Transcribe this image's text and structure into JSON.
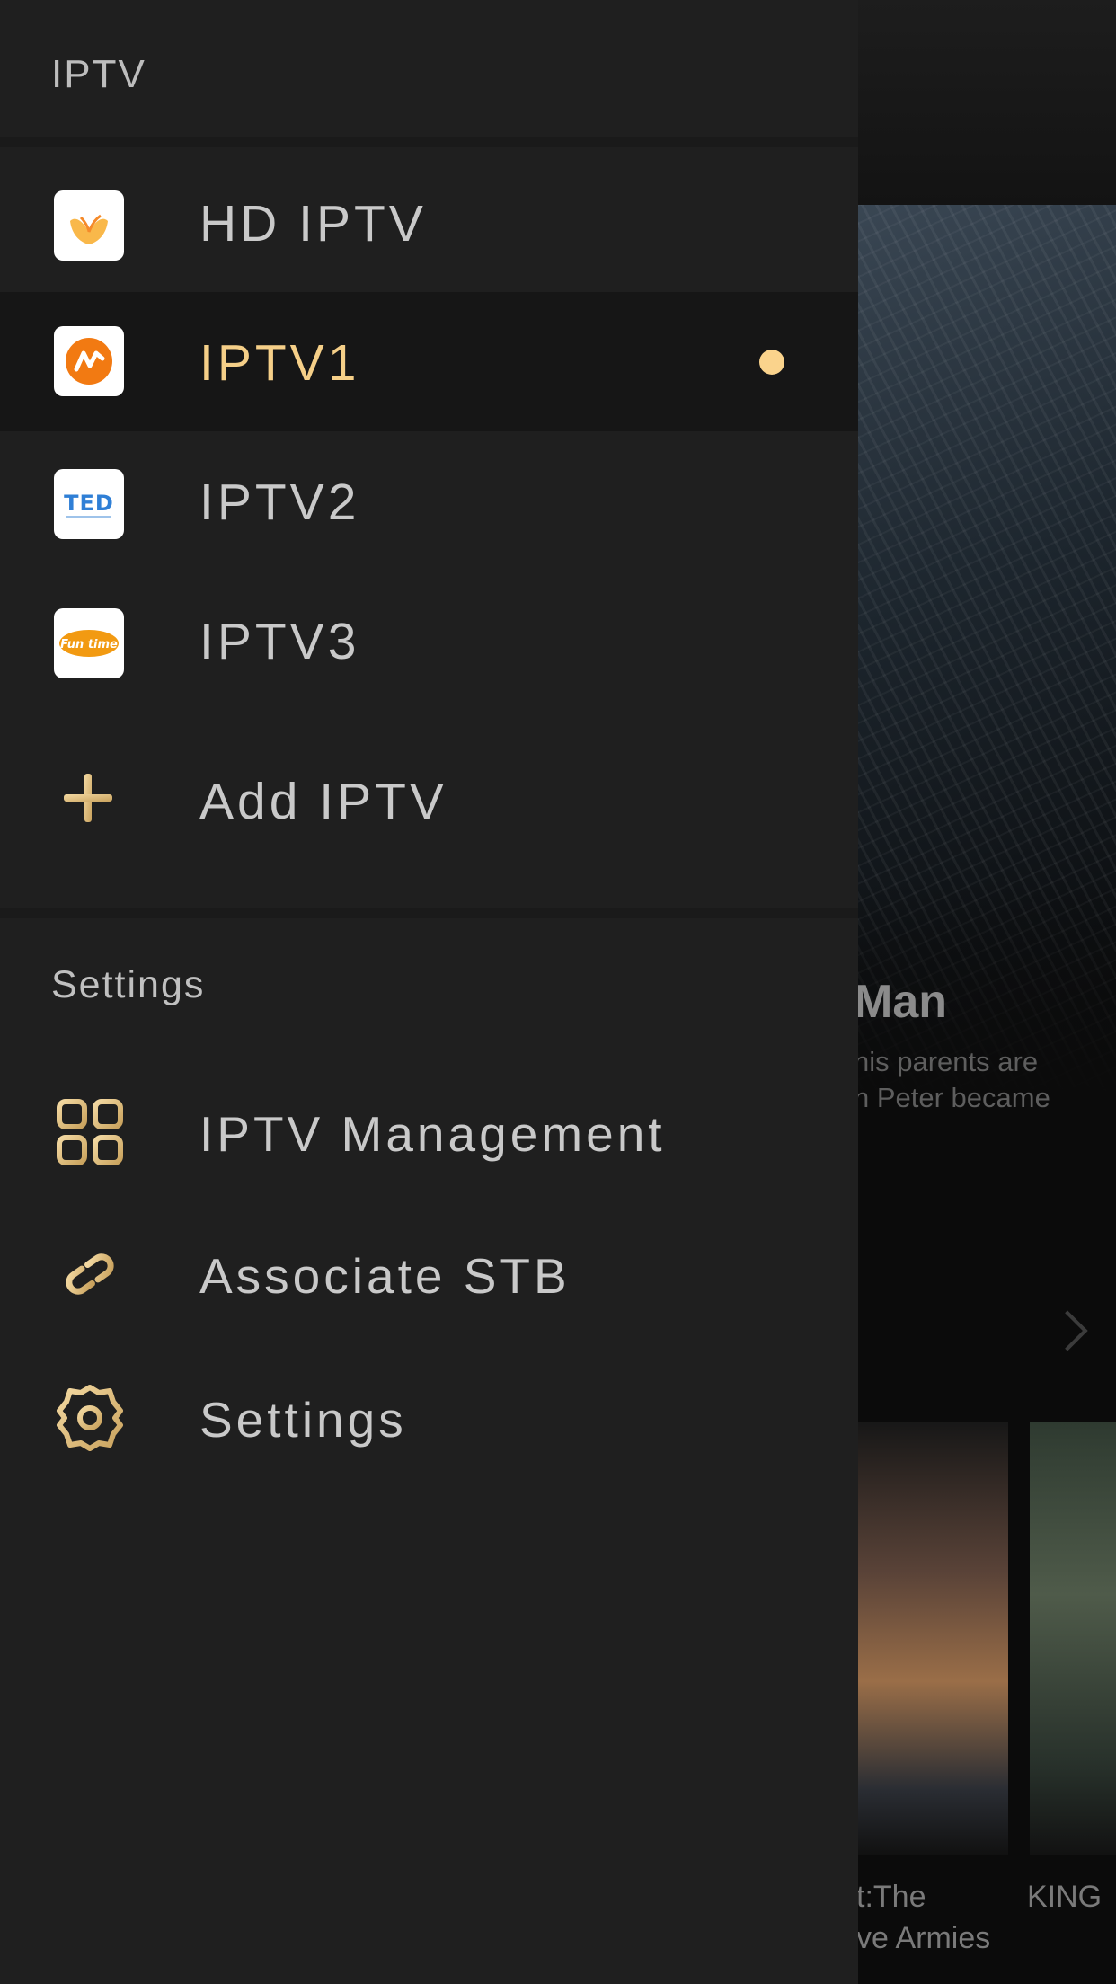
{
  "background": {
    "hero_title": "Man",
    "hero_description": "his parents are\nn Peter became",
    "posters": [
      {
        "title": "t:The\nve Armies"
      },
      {
        "title": "KING"
      }
    ]
  },
  "drawer": {
    "title": "IPTV",
    "items": [
      {
        "label": "HD IPTV",
        "icon": "hd-iptv-logo",
        "selected": false
      },
      {
        "label": "IPTV1",
        "icon": "iptv1-logo",
        "selected": true
      },
      {
        "label": "IPTV2",
        "icon": "ted-logo",
        "selected": false
      },
      {
        "label": "IPTV3",
        "icon": "fun-time-logo",
        "selected": false
      }
    ],
    "add_label": "Add IPTV",
    "settings_section_title": "Settings",
    "settings_items": [
      {
        "label": "IPTV Management",
        "icon": "grid-icon"
      },
      {
        "label": "Associate STB",
        "icon": "link-icon"
      },
      {
        "label": "Settings",
        "icon": "gear-icon"
      }
    ]
  },
  "colors": {
    "accent": "#f5cf88",
    "drawer_bg": "#1f1f1f",
    "selected_bg": "#161616",
    "text": "#c9c9c9"
  }
}
